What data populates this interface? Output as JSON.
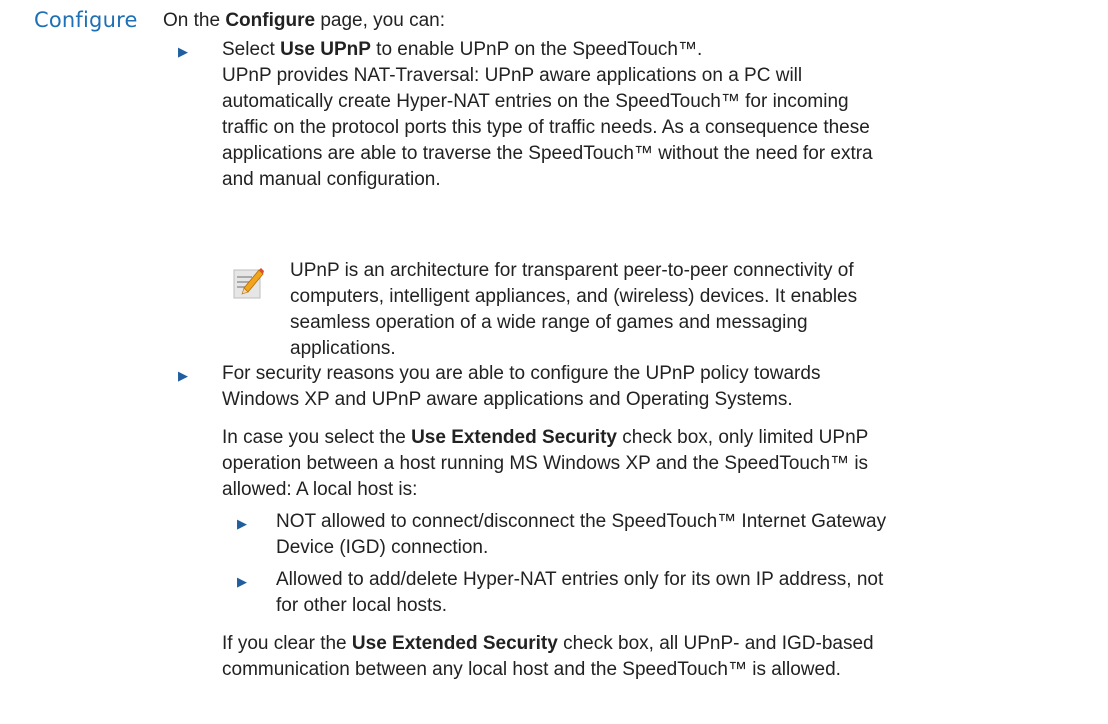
{
  "side_heading": "Configure",
  "intro": {
    "prefix": "On the ",
    "bold": "Configure",
    "suffix": " page, you can:"
  },
  "item1": {
    "prefix": "Select ",
    "bold": "Use UPnP",
    "suffix": " to enable UPnP on the SpeedTouch™.",
    "lines": [
      "UPnP provides NAT-Traversal: UPnP aware applications on a PC will",
      "automatically create Hyper-NAT entries on the SpeedTouch™ for incoming",
      "traffic on the protocol ports this type of traffic needs. As a consequence these",
      "applications are able to traverse the SpeedTouch™ without the need for extra",
      "and manual configuration."
    ]
  },
  "note": {
    "icon": "note-pencil-icon",
    "lines": [
      "UPnP is an architecture for transparent peer-to-peer connectivity of",
      "computers, intelligent appliances, and (wireless) devices. It enables",
      "seamless operation of a wide range of games and messaging",
      "applications."
    ]
  },
  "item2": {
    "lines": [
      "For security reasons you are able to configure the UPnP policy towards",
      "Windows XP and UPnP aware applications and Operating Systems."
    ]
  },
  "extended": {
    "prefix": "In case you select the ",
    "bold": "Use Extended Security",
    "suffix": " check box, only limited UPnP",
    "lines": [
      "operation between a host running MS Windows XP and the SpeedTouch™ is",
      "allowed: A local host is:"
    ]
  },
  "sub1": {
    "lines": [
      "NOT allowed to connect/disconnect the SpeedTouch™ Internet Gateway",
      "Device (IGD) connection."
    ]
  },
  "sub2": {
    "lines": [
      "Allowed to add/delete Hyper-NAT entries only for its own IP address, not",
      "for other local hosts."
    ]
  },
  "clear": {
    "prefix": "If you clear the ",
    "bold": "Use Extended Security",
    "suffix": " check box, all UPnP- and IGD-based",
    "lines": [
      "communication between any local host and the SpeedTouch™ is allowed."
    ]
  },
  "colors": {
    "heading": "#1f6fb5",
    "bullet": "#1f5f9f",
    "text": "#222222"
  }
}
